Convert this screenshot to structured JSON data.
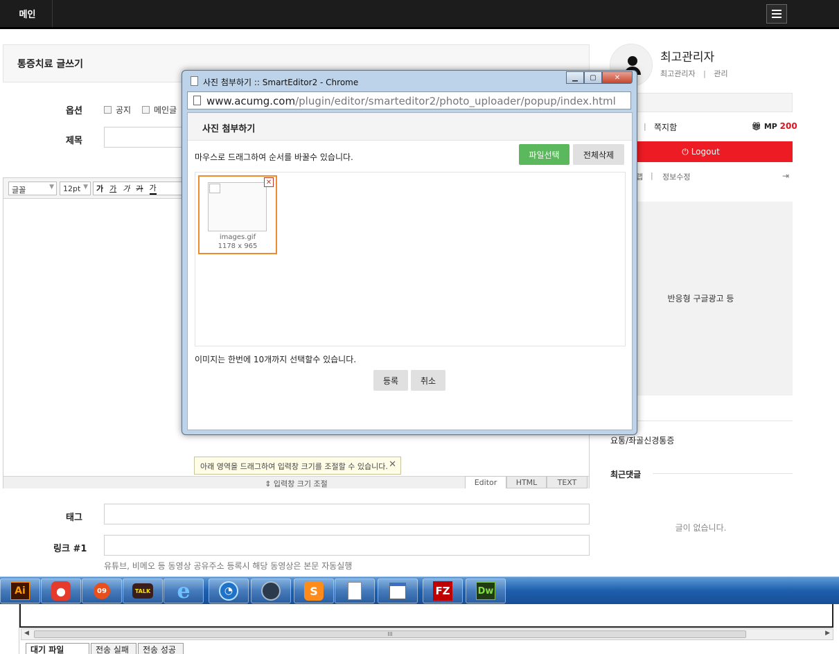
{
  "topnav": {
    "main_label": "메인",
    "menu_icon": "menu-icon"
  },
  "form": {
    "panel_title": "통증치료 글쓰기",
    "options_label": "옵션",
    "option_notice": "공지",
    "option_main": "메인글",
    "subject_label": "제목",
    "tag_label": "태그",
    "link_label": "링크 #1",
    "link_hint": "유튜브, 비메오 등 동영상 공유주소 등록시 해당 동영상은 본문 자동실행"
  },
  "editor": {
    "font_select": "글꼴",
    "size_select": "12pt",
    "tools": [
      "가",
      "가",
      "가",
      "가",
      "가"
    ],
    "resize_tip": "아래 영역을 드래그하여 입력창 크기를 조절할 수 있습니다.",
    "resize_label": "⇕ 입력창 크기 조절",
    "mode_tabs": [
      "Editor",
      "HTML",
      "TEXT"
    ]
  },
  "sidebar": {
    "user_name": "최고관리자",
    "user_sub": "최고관리자",
    "admin_link": "관리",
    "memo_link": "쪽지함",
    "mp_label": "MP",
    "mp_value": "200",
    "logout_label": "Logout",
    "scrap_partial": "랩",
    "info_edit": "정보수정",
    "ad_text": "반응형 구글광고 등",
    "recent_item": "요통/좌골신경통증",
    "recent_comments_title": "최근댓글",
    "empty_msg": "글이 없습니다.",
    "accent_color": "#ed1c24"
  },
  "popup": {
    "window_title": "사진 첨부하기 :: SmartEditor2 - Chrome",
    "url_host": "www.acumg.com",
    "url_path": "/plugin/editor/smarteditor2/photo_uploader/popup/index.html",
    "heading": "사진 첨부하기",
    "drag_desc": "마우스로 드래그하여 순서를 바꿀수 있습니다.",
    "select_file_btn": "파일선택",
    "delete_all_btn": "전체삭제",
    "image_name": "images.gif",
    "image_size": "1178 x 965",
    "limit_text": "이미지는 한번에 10개까지 선택할수 있습니다.",
    "register_btn": "등록",
    "cancel_btn": "취소",
    "green_color": "#5cb85c"
  },
  "taskbar": {
    "icons": [
      "illustrator-icon",
      "red-app-icon",
      "09-app-icon",
      "kakaotalk-icon",
      "internet-explorer-icon",
      "blue-globe-icon",
      "scanner-icon",
      "sublime-icon",
      "document-icon",
      "window-app-icon",
      "filezilla-icon",
      "dreamweaver-icon"
    ],
    "ai_label": "Ai",
    "talk_label": "TALK",
    "ie_label": "e",
    "fz_label": "FZ",
    "dw_label": "Dw",
    "n09_label": "09"
  },
  "bottom": {
    "tabs": [
      "대기 파일",
      "전송 실패",
      "전송 성공"
    ],
    "scroll_grip": "III"
  }
}
